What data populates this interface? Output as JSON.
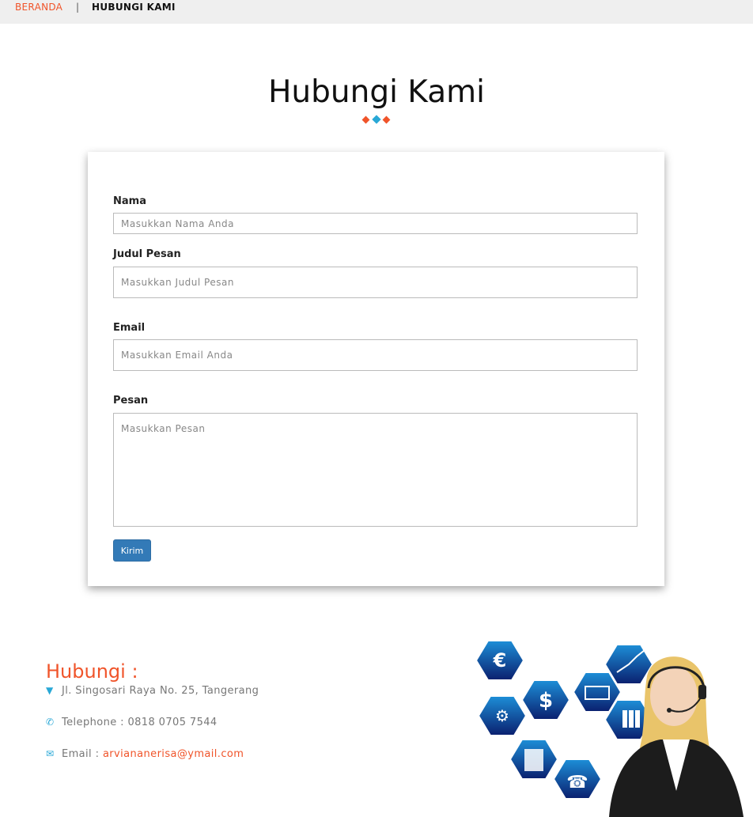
{
  "breadcrumb": {
    "home": "BERANDA",
    "separator": "|",
    "current": "HUBUNGI KAMI"
  },
  "page": {
    "title": "Hubungi Kami"
  },
  "colors": {
    "accent": "#f0542a",
    "secondary": "#29a8d6",
    "button": "#337ab7"
  },
  "form": {
    "nama": {
      "label": "Nama",
      "placeholder": "Masukkan Nama Anda"
    },
    "judul": {
      "label": "Judul Pesan",
      "placeholder": "Masukkan Judul Pesan"
    },
    "email": {
      "label": "Email",
      "placeholder": "Masukkan Email Anda"
    },
    "pesan": {
      "label": "Pesan",
      "placeholder": "Masukkan Pesan"
    },
    "submit_label": "Kirim"
  },
  "contact": {
    "title": "Hubungi :",
    "address": "Jl. Singosari Raya No. 25, Tangerang",
    "telephone": "Telephone : 0818 0705 7544",
    "email_label": "Email :",
    "email_value": "arviananerisa@ymail.com",
    "icons": {
      "address": "map-marker-icon",
      "telephone": "phone-icon",
      "email": "envelope-icon"
    }
  }
}
